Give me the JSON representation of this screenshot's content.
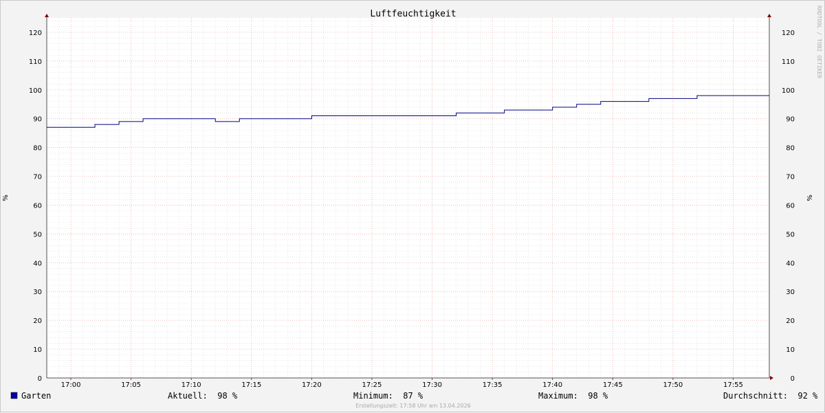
{
  "chart_data": {
    "type": "line",
    "title": "Luftfeuchtigkeit",
    "ylabel_left": "%",
    "ylabel_right": "%",
    "watermark": "RRDTOOL / TOBI OETIKER",
    "x_ticks": [
      "17:00",
      "17:05",
      "17:10",
      "17:15",
      "17:20",
      "17:25",
      "17:30",
      "17:35",
      "17:40",
      "17:45",
      "17:50",
      "17:55"
    ],
    "y_ticks": [
      "0",
      "10",
      "20",
      "30",
      "40",
      "50",
      "60",
      "70",
      "80",
      "90",
      "100",
      "110",
      "120"
    ],
    "ylim": [
      0,
      125
    ],
    "xlim": [
      "16:58",
      "17:58"
    ],
    "grid": true,
    "series": [
      {
        "name": "Garten",
        "color": "#000080",
        "x": [
          "16:58",
          "17:02",
          "17:04",
          "17:06",
          "17:08",
          "17:10",
          "17:12",
          "17:14",
          "17:16",
          "17:18",
          "17:20",
          "17:22",
          "17:24",
          "17:26",
          "17:28",
          "17:30",
          "17:32",
          "17:34",
          "17:36",
          "17:38",
          "17:40",
          "17:42",
          "17:44",
          "17:46",
          "17:48",
          "17:50",
          "17:52",
          "17:54",
          "17:56"
        ],
        "values": [
          87,
          88,
          89,
          90,
          90,
          90,
          89,
          90,
          90,
          90,
          91,
          91,
          91,
          91,
          91,
          91,
          92,
          92,
          93,
          93,
          94,
          95,
          96,
          96,
          97,
          97,
          98,
          98,
          98
        ]
      }
    ],
    "legend": {
      "position": "bottom",
      "swatch_color": "#0000a0",
      "series_label": "Garten",
      "aktuell": "Aktuell:  98 %",
      "minimum": "Minimum:  87 %",
      "maximum": "Maximum:  98 %",
      "durchschnitt": "Durchschnitt:  92 %"
    },
    "footer": "Erstellungszeit: 17:58 Uhr am 13.04.2026"
  },
  "colors": {
    "background": "#f3f3f3",
    "canvas": "#ffffff",
    "major_grid": "#e8a0a0",
    "minor_grid": "#d8d8d8",
    "axis": "#505050",
    "arrow": "#800000",
    "line": "#000080"
  }
}
